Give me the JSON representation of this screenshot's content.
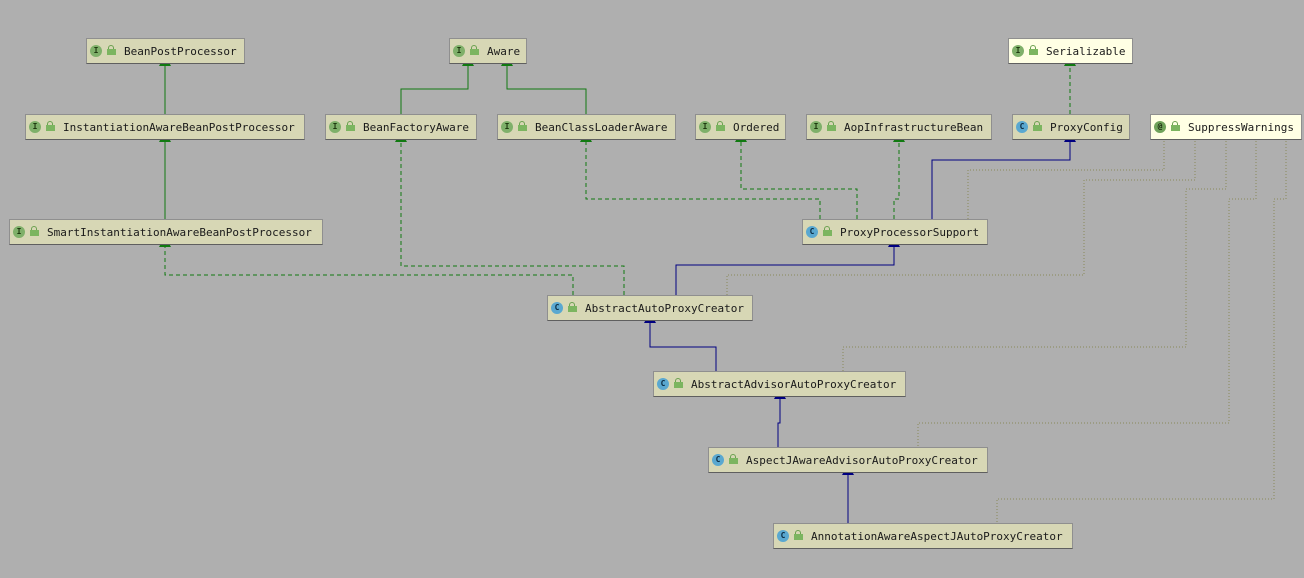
{
  "nodes": {
    "bean_post_processor": {
      "kind": "I",
      "label": "BeanPostProcessor"
    },
    "aware": {
      "kind": "I",
      "label": "Aware"
    },
    "serializable": {
      "kind": "I",
      "label": "Serializable"
    },
    "instantiation_aware_bpp": {
      "kind": "I",
      "label": "InstantiationAwareBeanPostProcessor"
    },
    "bean_factory_aware": {
      "kind": "I",
      "label": "BeanFactoryAware"
    },
    "bean_class_loader_aware": {
      "kind": "I",
      "label": "BeanClassLoaderAware"
    },
    "ordered": {
      "kind": "I",
      "label": "Ordered"
    },
    "aop_infrastructure_bean": {
      "kind": "I",
      "label": "AopInfrastructureBean"
    },
    "proxy_config": {
      "kind": "C",
      "label": "ProxyConfig"
    },
    "suppress_warnings": {
      "kind": "@",
      "label": "SuppressWarnings"
    },
    "smart_instantiation_aware_bpp": {
      "kind": "I",
      "label": "SmartInstantiationAwareBeanPostProcessor"
    },
    "proxy_processor_support": {
      "kind": "C",
      "label": "ProxyProcessorSupport"
    },
    "abstract_auto_proxy_creator": {
      "kind": "C",
      "label": "AbstractAutoProxyCreator"
    },
    "abstract_advisor_auto_proxy_creator": {
      "kind": "C",
      "label": "AbstractAdvisorAutoProxyCreator"
    },
    "aspectj_aware_advisor_auto_proxy_creator": {
      "kind": "C",
      "label": "AspectJAwareAdvisorAutoProxyCreator"
    },
    "annotation_aware_aspectj_auto_proxy_creator": {
      "kind": "C",
      "label": "AnnotationAwareAspectJAutoProxyCreator"
    }
  },
  "colors": {
    "background": "#afafaf",
    "node_fill": "#d7d7b5",
    "node_fill_light": "#ffffe4",
    "extends_edge": "#000080",
    "implements_edge": "#117a11",
    "annotation_edge": "#8a8a5a"
  }
}
